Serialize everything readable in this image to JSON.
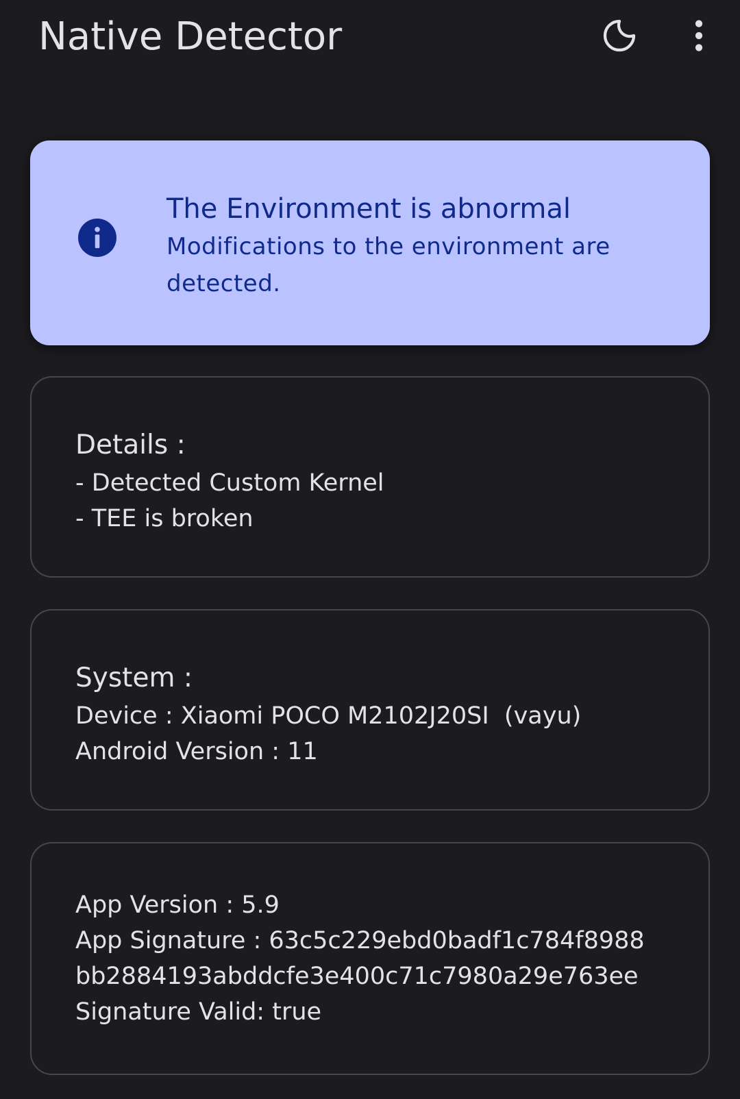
{
  "app_bar": {
    "title": "Native Detector",
    "actions": [
      {
        "icon": "moon-icon",
        "label": "Dark theme"
      },
      {
        "icon": "more-vert-icon",
        "label": "More options"
      }
    ]
  },
  "status_card": {
    "icon": "info-icon",
    "title": "The Environment is abnormal",
    "description": "Modifications to the environment are detected.",
    "background": "#bac3ff",
    "text_color": "#102a8c"
  },
  "details_card": {
    "heading": "Details :",
    "items": [
      "- Detected Custom Kernel",
      "- TEE is broken"
    ]
  },
  "system_card": {
    "heading": "System :",
    "device": "Device : Xiaomi POCO M2102J20SI  (vayu)",
    "android_version": "Android Version : 11"
  },
  "app_card": {
    "app_version": "App Version : 5.9",
    "signature_line1": "App Signature : 63c5c229ebd0badf1c784f8988",
    "signature_line2": "bb2884193abddcfe3e400c71c7980a29e763ee",
    "signature_valid": "Signature Valid: true"
  },
  "colors": {
    "background": "#1c1b20",
    "on_surface": "#e4e2e6",
    "outline": "#46464f"
  }
}
